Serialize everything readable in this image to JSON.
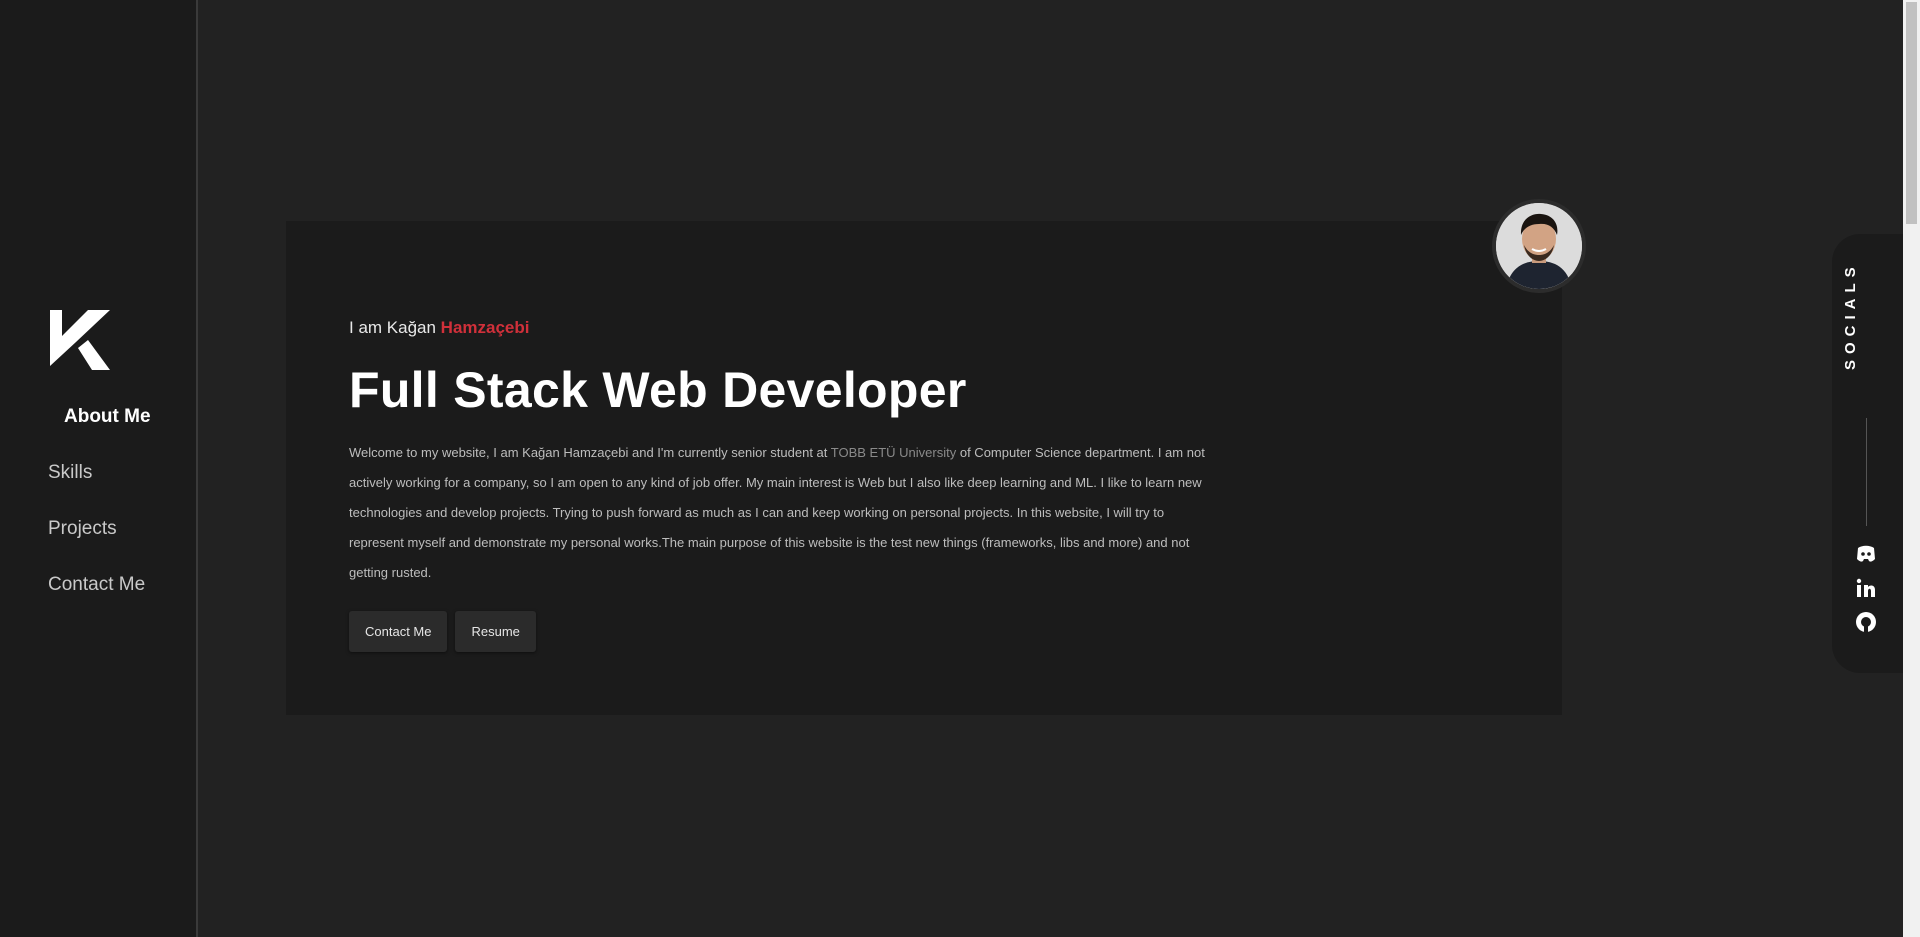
{
  "sidebar": {
    "logo_icon": "k-logo-icon",
    "items": [
      {
        "label": "About Me",
        "active": true
      },
      {
        "label": "Skills",
        "active": false
      },
      {
        "label": "Projects",
        "active": false
      },
      {
        "label": "Contact Me",
        "active": false
      }
    ]
  },
  "hero": {
    "intro_prefix": "I am Kağan ",
    "intro_accent": "Hamzaçebi",
    "headline": "Full Stack Web Developer",
    "bio_part1": "Welcome to my website, I am Kağan Hamzaçebi and I'm currently senior student at ",
    "bio_university": "TOBB ETÜ University",
    "bio_part2": " of Computer Science department. I am not actively working for a company, so I am open to any kind of job offer. My main interest is Web but I also like deep learning and ML. I like to learn new technologies and develop projects. Trying to push forward as much as I can and keep working on personal projects. In this website, I will try to represent myself and demonstrate my personal works.The main purpose of this website is the test new things (frameworks, libs and more) and not getting rusted.",
    "contact_label": "Contact Me",
    "resume_label": "Resume",
    "avatar_icon": "profile-photo"
  },
  "socials": {
    "label": "SOCIALS",
    "icons": [
      "discord-icon",
      "linkedin-icon",
      "github-icon"
    ]
  },
  "colors": {
    "background": "#222222",
    "sidebar": "#1b1b1b",
    "card": "#1b1b1b",
    "accent": "#d0303a"
  }
}
